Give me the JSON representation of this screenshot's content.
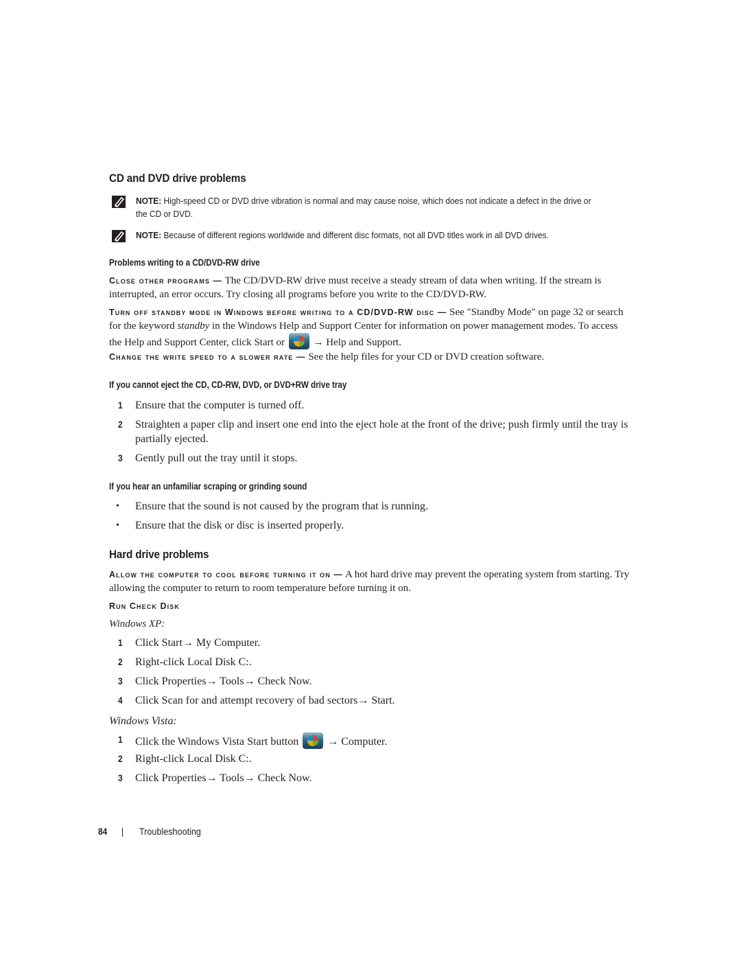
{
  "sections": {
    "cd_dvd": {
      "title": "CD and DVD drive problems",
      "notes": [
        {
          "label": "NOTE:",
          "text": " High-speed CD or DVD drive vibration is normal and may cause noise, which does not indicate a defect in the drive or the CD or DVD."
        },
        {
          "label": "NOTE:",
          "text": " Because of different regions worldwide and different disc formats, not all DVD titles work in all DVD drives."
        }
      ],
      "writing": {
        "heading": "Problems writing to a CD/DVD-RW drive",
        "items": [
          {
            "lead": "Close other programs —",
            "text": " The CD/DVD-RW drive must receive a steady stream of data when writing. If the stream is interrupted, an error occurs. Try closing all programs before you write to the CD/DVD-RW."
          },
          {
            "lead": "Turn off standby mode in Windows before writing to a CD/DVD-RW disc —",
            "text_a": " See \"Standby Mode\" on page 32 or search for the keyword ",
            "keyword": "standby",
            "text_b": " in the Windows Help and Support Center for information on power management modes. To access the Help and Support Center, click ",
            "start": "Start",
            "or": " or ",
            "arrow": " → ",
            "help": "Help and Support",
            "end": "."
          },
          {
            "lead": "Change the write speed to a slower rate —",
            "text": " See the help files for your CD or DVD creation software."
          }
        ]
      },
      "eject": {
        "heading": "If you cannot eject the CD, CD-RW, DVD, or DVD+RW drive tray",
        "steps": [
          {
            "num": "1",
            "text": "Ensure that the computer is turned off."
          },
          {
            "num": "2",
            "text": "Straighten a paper clip and insert one end into the eject hole at the front of the drive; push firmly until the tray is partially ejected."
          },
          {
            "num": "3",
            "text": "Gently pull out the tray until it stops."
          }
        ]
      },
      "sound": {
        "heading": "If you hear an unfamiliar scraping or grinding sound",
        "bullets": [
          "Ensure that the sound is not caused by the program that is running.",
          "Ensure that the disk or disc is inserted properly."
        ]
      }
    },
    "hard_drive": {
      "title": "Hard drive problems",
      "cool": {
        "lead": "Allow the computer to cool before turning it on —",
        "text": " A hot hard drive may prevent the operating system from starting. Try allowing the computer to return to room temperature before turning it on."
      },
      "check_disk": {
        "lead": "Run Check Disk",
        "xp_label": "Windows XP:",
        "xp_steps": [
          {
            "num": "1",
            "text": "Click Start→ My Computer."
          },
          {
            "num": "2",
            "text": "Right-click Local Disk C:."
          },
          {
            "num": "3",
            "text": "Click Properties→ Tools→ Check Now."
          },
          {
            "num": "4",
            "text": "Click Scan for and attempt recovery of bad sectors→ Start."
          }
        ],
        "vista_label": "Windows Vista:",
        "vista_steps": [
          {
            "num": "1",
            "text_a": "Click the Windows Vista Start button ",
            "text_b": " → Computer."
          },
          {
            "num": "2",
            "text": "Right-click Local Disk C:."
          },
          {
            "num": "3",
            "text": "Click Properties→ Tools→ Check Now."
          }
        ]
      }
    }
  },
  "footer": {
    "page_number": "84",
    "section": "Troubleshooting"
  },
  "icons": {
    "note": "pencil-note-icon",
    "windows_start": "windows-start-icon"
  }
}
